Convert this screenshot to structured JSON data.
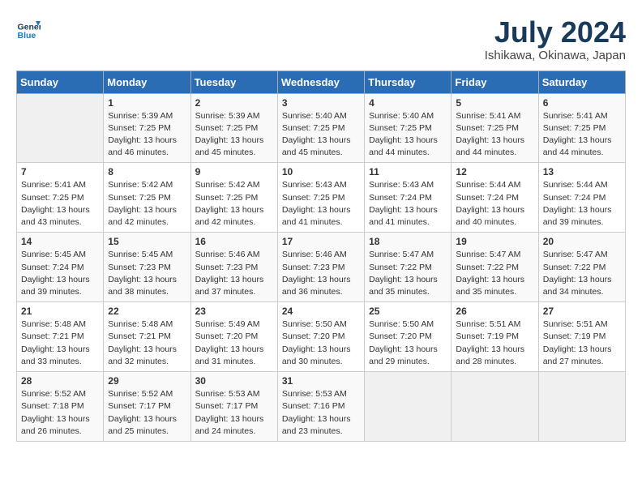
{
  "header": {
    "logo_line1": "General",
    "logo_line2": "Blue",
    "month": "July 2024",
    "location": "Ishikawa, Okinawa, Japan"
  },
  "days_of_week": [
    "Sunday",
    "Monday",
    "Tuesday",
    "Wednesday",
    "Thursday",
    "Friday",
    "Saturday"
  ],
  "weeks": [
    [
      {
        "day": "",
        "info": ""
      },
      {
        "day": "1",
        "info": "Sunrise: 5:39 AM\nSunset: 7:25 PM\nDaylight: 13 hours\nand 46 minutes."
      },
      {
        "day": "2",
        "info": "Sunrise: 5:39 AM\nSunset: 7:25 PM\nDaylight: 13 hours\nand 45 minutes."
      },
      {
        "day": "3",
        "info": "Sunrise: 5:40 AM\nSunset: 7:25 PM\nDaylight: 13 hours\nand 45 minutes."
      },
      {
        "day": "4",
        "info": "Sunrise: 5:40 AM\nSunset: 7:25 PM\nDaylight: 13 hours\nand 44 minutes."
      },
      {
        "day": "5",
        "info": "Sunrise: 5:41 AM\nSunset: 7:25 PM\nDaylight: 13 hours\nand 44 minutes."
      },
      {
        "day": "6",
        "info": "Sunrise: 5:41 AM\nSunset: 7:25 PM\nDaylight: 13 hours\nand 44 minutes."
      }
    ],
    [
      {
        "day": "7",
        "info": "Sunrise: 5:41 AM\nSunset: 7:25 PM\nDaylight: 13 hours\nand 43 minutes."
      },
      {
        "day": "8",
        "info": "Sunrise: 5:42 AM\nSunset: 7:25 PM\nDaylight: 13 hours\nand 42 minutes."
      },
      {
        "day": "9",
        "info": "Sunrise: 5:42 AM\nSunset: 7:25 PM\nDaylight: 13 hours\nand 42 minutes."
      },
      {
        "day": "10",
        "info": "Sunrise: 5:43 AM\nSunset: 7:25 PM\nDaylight: 13 hours\nand 41 minutes."
      },
      {
        "day": "11",
        "info": "Sunrise: 5:43 AM\nSunset: 7:24 PM\nDaylight: 13 hours\nand 41 minutes."
      },
      {
        "day": "12",
        "info": "Sunrise: 5:44 AM\nSunset: 7:24 PM\nDaylight: 13 hours\nand 40 minutes."
      },
      {
        "day": "13",
        "info": "Sunrise: 5:44 AM\nSunset: 7:24 PM\nDaylight: 13 hours\nand 39 minutes."
      }
    ],
    [
      {
        "day": "14",
        "info": "Sunrise: 5:45 AM\nSunset: 7:24 PM\nDaylight: 13 hours\nand 39 minutes."
      },
      {
        "day": "15",
        "info": "Sunrise: 5:45 AM\nSunset: 7:23 PM\nDaylight: 13 hours\nand 38 minutes."
      },
      {
        "day": "16",
        "info": "Sunrise: 5:46 AM\nSunset: 7:23 PM\nDaylight: 13 hours\nand 37 minutes."
      },
      {
        "day": "17",
        "info": "Sunrise: 5:46 AM\nSunset: 7:23 PM\nDaylight: 13 hours\nand 36 minutes."
      },
      {
        "day": "18",
        "info": "Sunrise: 5:47 AM\nSunset: 7:22 PM\nDaylight: 13 hours\nand 35 minutes."
      },
      {
        "day": "19",
        "info": "Sunrise: 5:47 AM\nSunset: 7:22 PM\nDaylight: 13 hours\nand 35 minutes."
      },
      {
        "day": "20",
        "info": "Sunrise: 5:47 AM\nSunset: 7:22 PM\nDaylight: 13 hours\nand 34 minutes."
      }
    ],
    [
      {
        "day": "21",
        "info": "Sunrise: 5:48 AM\nSunset: 7:21 PM\nDaylight: 13 hours\nand 33 minutes."
      },
      {
        "day": "22",
        "info": "Sunrise: 5:48 AM\nSunset: 7:21 PM\nDaylight: 13 hours\nand 32 minutes."
      },
      {
        "day": "23",
        "info": "Sunrise: 5:49 AM\nSunset: 7:20 PM\nDaylight: 13 hours\nand 31 minutes."
      },
      {
        "day": "24",
        "info": "Sunrise: 5:50 AM\nSunset: 7:20 PM\nDaylight: 13 hours\nand 30 minutes."
      },
      {
        "day": "25",
        "info": "Sunrise: 5:50 AM\nSunset: 7:20 PM\nDaylight: 13 hours\nand 29 minutes."
      },
      {
        "day": "26",
        "info": "Sunrise: 5:51 AM\nSunset: 7:19 PM\nDaylight: 13 hours\nand 28 minutes."
      },
      {
        "day": "27",
        "info": "Sunrise: 5:51 AM\nSunset: 7:19 PM\nDaylight: 13 hours\nand 27 minutes."
      }
    ],
    [
      {
        "day": "28",
        "info": "Sunrise: 5:52 AM\nSunset: 7:18 PM\nDaylight: 13 hours\nand 26 minutes."
      },
      {
        "day": "29",
        "info": "Sunrise: 5:52 AM\nSunset: 7:17 PM\nDaylight: 13 hours\nand 25 minutes."
      },
      {
        "day": "30",
        "info": "Sunrise: 5:53 AM\nSunset: 7:17 PM\nDaylight: 13 hours\nand 24 minutes."
      },
      {
        "day": "31",
        "info": "Sunrise: 5:53 AM\nSunset: 7:16 PM\nDaylight: 13 hours\nand 23 minutes."
      },
      {
        "day": "",
        "info": ""
      },
      {
        "day": "",
        "info": ""
      },
      {
        "day": "",
        "info": ""
      }
    ]
  ]
}
